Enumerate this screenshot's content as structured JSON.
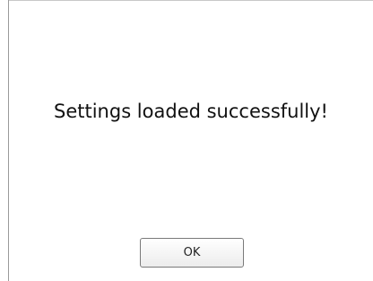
{
  "dialog": {
    "message": "Settings loaded successfully!",
    "ok_label": "OK"
  }
}
